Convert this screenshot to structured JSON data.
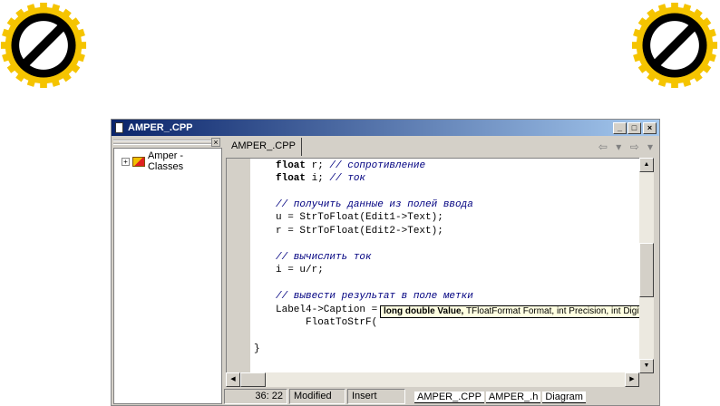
{
  "badges": {
    "icon": "no-entry-icon",
    "colors": {
      "ring": "#000000",
      "gear": "#f5c400"
    }
  },
  "window": {
    "title": "AMPER_.CPP",
    "buttons": [
      "_",
      "□",
      "×"
    ]
  },
  "class_tree": {
    "items": [
      {
        "label": "Amper - Classes"
      }
    ]
  },
  "editor": {
    "tab": "AMPER_.CPP",
    "nav": "⇦ ▾ ⇨ ▾",
    "lines": [
      {
        "kw": "float",
        "rest": " r; ",
        "cm": "// сопротивление"
      },
      {
        "kw": "float",
        "rest": " i; ",
        "cm": "// ток"
      },
      {
        "cm": "// получить данные из полей ввода"
      },
      {
        "rest": "u = StrToFloat(Edit1->Text);"
      },
      {
        "rest": "r = StrToFloat(Edit2->Text);"
      },
      {
        "cm": "// вычислить ток"
      },
      {
        "rest": "i = u/r;"
      },
      {
        "cm": "// вывести результат в поле метки"
      },
      {
        "rest": "Label4->Caption ="
      },
      {
        "rest": "     FloatToStrF("
      },
      {
        "rest": "}"
      }
    ],
    "tooltip": {
      "bold": "long double Value,",
      "rest": " TFloatFormat Format, int Precision, int Digits"
    }
  },
  "status": {
    "position": "36: 22",
    "modified": "Modified",
    "mode": "Insert",
    "file_tabs": [
      "AMPER_.CPP",
      "AMPER_.h",
      "Diagram"
    ]
  }
}
